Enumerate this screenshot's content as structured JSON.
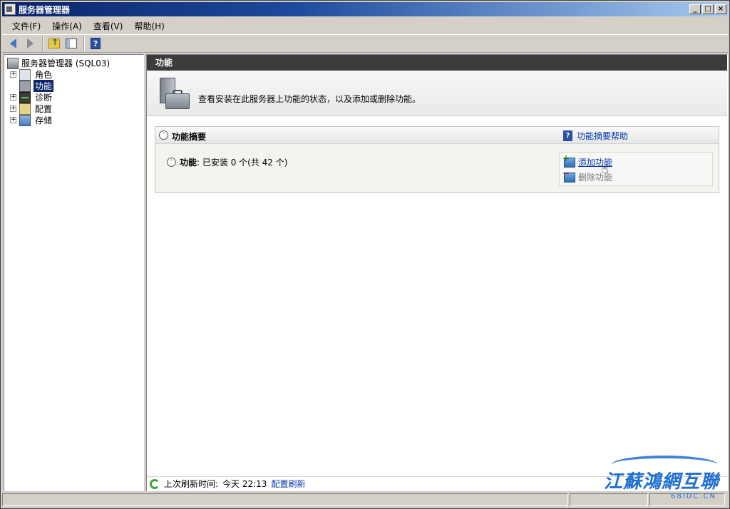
{
  "window": {
    "title": "服务器管理器",
    "controls": [
      "_",
      "□",
      "×"
    ]
  },
  "menu": {
    "items": [
      "文件(F)",
      "操作(A)",
      "查看(V)",
      "帮助(H)"
    ]
  },
  "toolbar": {
    "buttons": [
      "back-icon",
      "forward-icon",
      "up-folder-icon",
      "show-hide-tree-icon",
      "help-icon"
    ]
  },
  "tree": {
    "root": "服务器管理器 (SQL03)",
    "items": [
      {
        "label": "角色",
        "icon": "roles-icon",
        "expandable": true
      },
      {
        "label": "功能",
        "icon": "features-icon",
        "expandable": false,
        "selected": true
      },
      {
        "label": "诊断",
        "icon": "diagnostics-icon",
        "expandable": true
      },
      {
        "label": "配置",
        "icon": "configuration-icon",
        "expandable": true
      },
      {
        "label": "存储",
        "icon": "storage-icon",
        "expandable": true
      }
    ],
    "expander_symbol": "+"
  },
  "main": {
    "header": "功能",
    "intro": "查看安装在此服务器上功能的状态，以及添加或删除功能。",
    "summary": {
      "title": "功能摘要",
      "help_link": "功能摘要帮助",
      "features_label": "功能",
      "features_status": ": 已安装 0 个(共 42 个)",
      "actions": {
        "add": "添加功能",
        "remove": "删除功能"
      },
      "collapse_symbol": "˄"
    },
    "status": {
      "last_refresh_label": "上次刷新时间:",
      "last_refresh_value": "今天 22:13",
      "config_refresh": "配置刷新"
    }
  },
  "watermark": {
    "text": "江蘇鴻網互聯",
    "sub": "68IDC.CN"
  },
  "colors": {
    "titlebar": "#0a246a",
    "header_bar": "#3c3c3c",
    "selection": "#0a246a",
    "link": "#0033aa",
    "watermark": "#1f6fd1"
  }
}
